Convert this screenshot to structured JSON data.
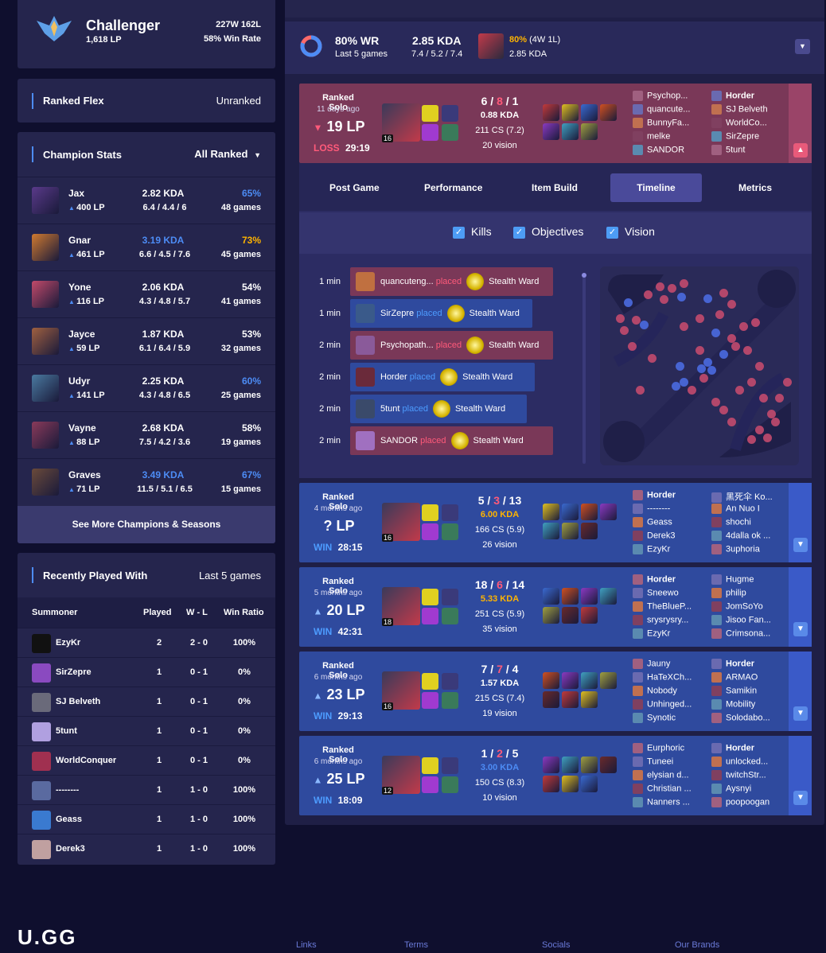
{
  "rank": {
    "tier": "Challenger",
    "lp": "1,618 LP",
    "record": "227W 162L",
    "winrate": "58% Win Rate"
  },
  "flex": {
    "label": "Ranked Flex",
    "value": "Unranked"
  },
  "champ_stats": {
    "title": "Champion Stats",
    "filter": "All Ranked",
    "rows": [
      {
        "name": "Jax",
        "lp": "400 LP",
        "kda": "2.82 KDA",
        "kda_detail": "6.4 / 4.4 / 6",
        "wr": "65%",
        "games": "48 games",
        "kda_color": "#ffffff",
        "wr_color": "#4d8cf5"
      },
      {
        "name": "Gnar",
        "lp": "461 LP",
        "kda": "3.19 KDA",
        "kda_detail": "6.6 / 4.5 / 7.6",
        "wr": "73%",
        "games": "45 games",
        "kda_color": "#4d8cf5",
        "wr_color": "#ffb400"
      },
      {
        "name": "Yone",
        "lp": "116 LP",
        "kda": "2.06 KDA",
        "kda_detail": "4.3 / 4.8 / 5.7",
        "wr": "54%",
        "games": "41 games",
        "kda_color": "#ffffff",
        "wr_color": "#ffffff"
      },
      {
        "name": "Jayce",
        "lp": "59 LP",
        "kda": "1.87 KDA",
        "kda_detail": "6.1 / 6.4 / 5.9",
        "wr": "53%",
        "games": "32 games",
        "kda_color": "#ffffff",
        "wr_color": "#ffffff"
      },
      {
        "name": "Udyr",
        "lp": "141 LP",
        "kda": "2.25 KDA",
        "kda_detail": "4.3 / 4.8 / 6.5",
        "wr": "60%",
        "games": "25 games",
        "kda_color": "#ffffff",
        "wr_color": "#4d8cf5"
      },
      {
        "name": "Vayne",
        "lp": "88 LP",
        "kda": "2.68 KDA",
        "kda_detail": "7.5 / 4.2 / 3.6",
        "wr": "58%",
        "games": "19 games",
        "kda_color": "#ffffff",
        "wr_color": "#ffffff"
      },
      {
        "name": "Graves",
        "lp": "71 LP",
        "kda": "3.49 KDA",
        "kda_detail": "11.5 / 5.1 / 6.5",
        "wr": "67%",
        "games": "15 games",
        "kda_color": "#4d8cf5",
        "wr_color": "#4d8cf5"
      }
    ],
    "more": "See More Champions & Seasons"
  },
  "recent": {
    "title": "Recently Played With",
    "range": "Last 5 games",
    "headers": [
      "Summoner",
      "Played",
      "W - L",
      "Win Ratio"
    ],
    "rows": [
      {
        "name": "EzyKr",
        "played": "2",
        "wl": "2 - 0",
        "ratio": "100%"
      },
      {
        "name": "SirZepre",
        "played": "1",
        "wl": "0 - 1",
        "ratio": "0%"
      },
      {
        "name": "SJ Belveth",
        "played": "1",
        "wl": "0 - 1",
        "ratio": "0%"
      },
      {
        "name": "5tunt",
        "played": "1",
        "wl": "0 - 1",
        "ratio": "0%"
      },
      {
        "name": "WorldConquer",
        "played": "1",
        "wl": "0 - 1",
        "ratio": "0%"
      },
      {
        "name": "--------",
        "played": "1",
        "wl": "1 - 0",
        "ratio": "100%"
      },
      {
        "name": "Geass",
        "played": "1",
        "wl": "1 - 0",
        "ratio": "100%"
      },
      {
        "name": "Derek3",
        "played": "1",
        "wl": "1 - 0",
        "ratio": "100%"
      }
    ]
  },
  "summary": {
    "wr": "80% WR",
    "wr_sub": "Last 5 games",
    "kda": "2.85 KDA",
    "kda_sub": "7.4 / 5.2 / 7.4",
    "champ_wr": "80%",
    "champ_record": "(4W 1L)",
    "champ_kda": "2.85 KDA",
    "winrate_fraction": 0.8
  },
  "tabs": [
    "Post Game",
    "Performance",
    "Item Build",
    "Timeline",
    "Metrics"
  ],
  "filters": [
    "Kills",
    "Objectives",
    "Vision"
  ],
  "timeline": [
    {
      "time": "1 min",
      "player": "quancuteng...",
      "action": "placed",
      "ward": "Stealth Ward",
      "team": "red"
    },
    {
      "time": "1 min",
      "player": "SirZepre",
      "action": "placed",
      "ward": "Stealth Ward",
      "team": "blue"
    },
    {
      "time": "2 min",
      "player": "Psychopath...",
      "action": "placed",
      "ward": "Stealth Ward",
      "team": "red"
    },
    {
      "time": "2 min",
      "player": "Horder",
      "action": "placed",
      "ward": "Stealth Ward",
      "team": "blue"
    },
    {
      "time": "2 min",
      "player": "5tunt",
      "action": "placed",
      "ward": "Stealth Ward",
      "team": "blue"
    },
    {
      "time": "2 min",
      "player": "SANDOR",
      "action": "placed",
      "ward": "Stealth Ward",
      "team": "red"
    }
  ],
  "matches": [
    {
      "result": "LOSS",
      "type": "Ranked Solo",
      "ago": "11 days ago",
      "lp": "19 LP",
      "lp_prefix": "▼",
      "duration": "29:19",
      "k": "6",
      "d": "8",
      "a": "1",
      "kda": "0.88 KDA",
      "kda_color": "#ffffff",
      "cs": "211 CS (7.2)",
      "vision": "20 vision",
      "level": "16",
      "team1": [
        "Psychop...",
        "quancute...",
        "BunnyFa...",
        "melke",
        "SANDOR"
      ],
      "team2": [
        "Horder",
        "SJ Belveth",
        "WorldCo...",
        "SirZepre",
        "5tunt"
      ]
    },
    {
      "result": "WIN",
      "type": "Ranked Solo",
      "ago": "4 months ago",
      "lp": "? LP",
      "lp_prefix": "",
      "duration": "28:15",
      "k": "5",
      "d": "3",
      "a": "13",
      "kda": "6.00 KDA",
      "kda_color": "#ffb400",
      "cs": "166 CS (5.9)",
      "vision": "26 vision",
      "level": "16",
      "team1": [
        "Horder",
        "--------",
        "Geass",
        "Derek3",
        "EzyKr"
      ],
      "team2": [
        "黑死伞 Ko...",
        "An Nuo I",
        "shochi",
        "4dalla ok ...",
        "3uphoria"
      ]
    },
    {
      "result": "WIN",
      "type": "Ranked Solo",
      "ago": "5 months ago",
      "lp": "20 LP",
      "lp_prefix": "▲",
      "duration": "42:31",
      "k": "18",
      "d": "6",
      "a": "14",
      "kda": "5.33 KDA",
      "kda_color": "#ffb400",
      "cs": "251 CS (5.9)",
      "vision": "35 vision",
      "level": "18",
      "team1": [
        "Horder",
        "Sneewo",
        "TheBlueP...",
        "srysrysry...",
        "EzyKr"
      ],
      "team2": [
        "Hugme",
        "philip",
        "JomSoYo",
        "Jisoo Fan...",
        "Crimsona..."
      ]
    },
    {
      "result": "WIN",
      "type": "Ranked Solo",
      "ago": "6 months ago",
      "lp": "23 LP",
      "lp_prefix": "▲",
      "duration": "29:13",
      "k": "7",
      "d": "7",
      "a": "4",
      "kda": "1.57 KDA",
      "kda_color": "#ffffff",
      "cs": "215 CS (7.4)",
      "vision": "19 vision",
      "level": "16",
      "team1": [
        "Jauny",
        "HaTeXCh...",
        "Nobody",
        "Unhinged...",
        "Synotic"
      ],
      "team2": [
        "Horder",
        "ARMAO",
        "Samikin",
        "Mobility",
        "Solodabo..."
      ]
    },
    {
      "result": "WIN",
      "type": "Ranked Solo",
      "ago": "6 months ago",
      "lp": "25 LP",
      "lp_prefix": "▲",
      "duration": "18:09",
      "k": "1",
      "d": "2",
      "a": "5",
      "kda": "3.00 KDA",
      "kda_color": "#4d8cf5",
      "cs": "150 CS (8.3)",
      "vision": "10 vision",
      "level": "12",
      "team1": [
        "Eurphoric",
        "Tuneei",
        "elysian d...",
        "Christian ...",
        "Nanners ..."
      ],
      "team2": [
        "Horder",
        "unlocked...",
        "twitchStr...",
        "Aysnyi",
        "poopoogan"
      ]
    }
  ],
  "footer": {
    "logo": "U.GG",
    "links": [
      "Links",
      "Terms",
      "Socials",
      "Our Brands"
    ]
  }
}
